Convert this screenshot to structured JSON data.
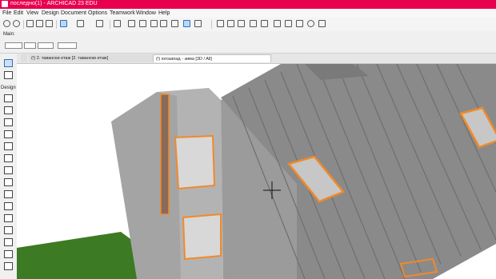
{
  "window": {
    "title": "последно(1) - ARCHICAD 23 EDU"
  },
  "menu": [
    "File",
    "Edit",
    "View",
    "Design",
    "Document",
    "Options",
    "Teamwork",
    "Window",
    "Help"
  ],
  "infobox": {
    "label": "Main:"
  },
  "toolbox": {
    "section_label": "Design"
  },
  "tabs": [
    {
      "label": "(!) 2. тавански етаж [2. тавански етаж]",
      "active": false
    },
    {
      "label": "(!) югозапад - зима [3D / All]",
      "active": true
    }
  ],
  "colors": {
    "title_bar": "#e8004e",
    "selection_highlight": "#f08a2a",
    "roof": "#8a8a8a",
    "wall": "#a9a9a9",
    "ground": "#3c7a23"
  }
}
